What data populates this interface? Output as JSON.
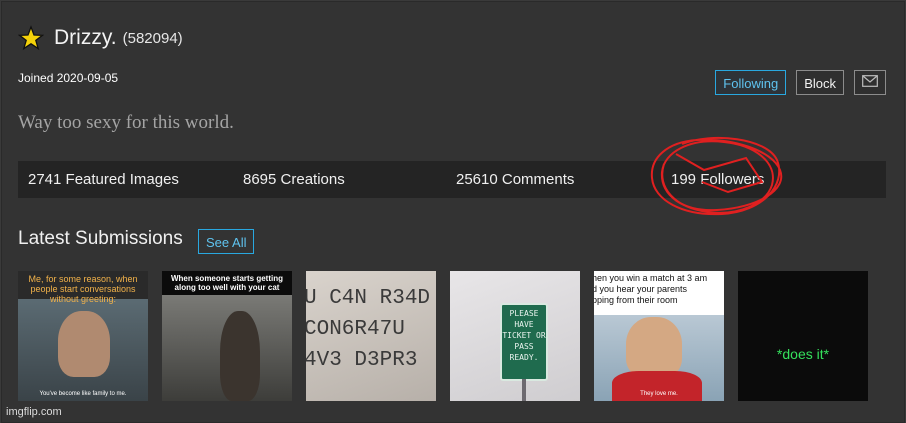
{
  "profile": {
    "username": "Drizzy.",
    "points": "(582094)",
    "joined": "Joined 2020-09-05",
    "bio": "Way too sexy for this world."
  },
  "actions": {
    "following_label": "Following",
    "block_label": "Block"
  },
  "stats": [
    {
      "label": "2741 Featured Images"
    },
    {
      "label": "8695 Creations"
    },
    {
      "label": "25610 Comments"
    },
    {
      "label": "199 Followers"
    }
  ],
  "latest": {
    "title": "Latest Submissions",
    "see_all": "See All"
  },
  "thumbnails": [
    {
      "caption": "Me, for some reason, when people start conversations without greeting:",
      "subcaption": "You've become like family to me."
    },
    {
      "caption": "When someone starts getting along too well with your cat"
    },
    {
      "caption": "U C4N R34D\nCON6R47U\n4V3 D3PR3"
    },
    {
      "caption": "PLEASE HAVE TICKET OR PASS READY."
    },
    {
      "caption": "hen you win a match at 3 am\nd you hear your parents\npping from their room",
      "subcaption": "They love me."
    },
    {
      "caption": "*does it*"
    }
  ],
  "footer": {
    "watermark": "imgflip.com"
  },
  "colors": {
    "accent": "#29a8e0",
    "star": "#f5d20a",
    "scribble": "#e02020"
  },
  "icons": {
    "star": "star-icon",
    "mail": "mail-icon"
  }
}
